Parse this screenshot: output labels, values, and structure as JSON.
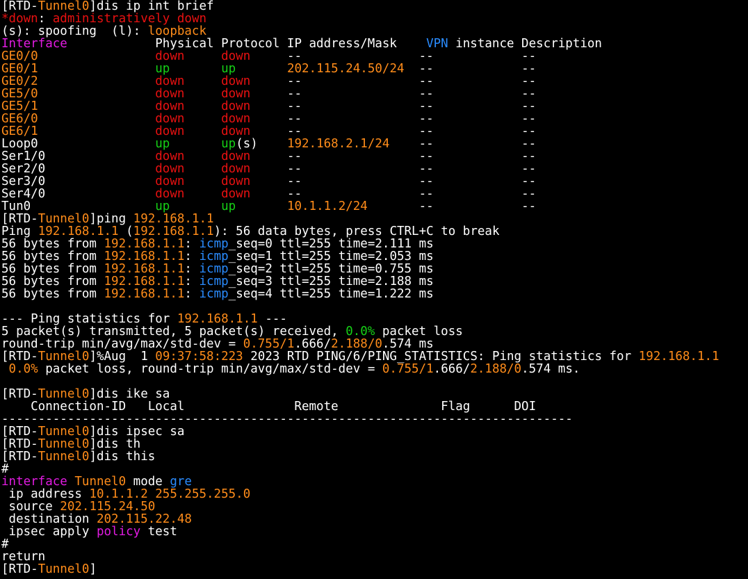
{
  "colors": {
    "background": "#000000",
    "default_text": "#ffffff",
    "orange": "#ff8c1a",
    "red": "#e81111",
    "green": "#16d116",
    "magenta": "#e21be2",
    "blue": "#2a8cff"
  },
  "lines": [
    [
      [
        "w",
        "[RTD-"
      ],
      [
        "o",
        "Tunnel0"
      ],
      [
        "w",
        "]dis ip int brief"
      ]
    ],
    [
      [
        "r",
        "*down"
      ],
      [
        "w",
        ": "
      ],
      [
        "r",
        "administratively down"
      ]
    ],
    [
      [
        "w",
        "(s): spoofing  (l): "
      ],
      [
        "o",
        "loopback"
      ]
    ],
    [
      [
        "m",
        "Interface"
      ],
      [
        "w",
        "            Physical Protocol IP address/Mask    "
      ],
      [
        "b",
        "VPN"
      ],
      [
        "w",
        " instance Description"
      ]
    ],
    [
      [
        "o",
        "GE0/0"
      ],
      [
        "w",
        "                "
      ],
      [
        "r",
        "down"
      ],
      [
        "w",
        "     "
      ],
      [
        "r",
        "down"
      ],
      [
        "w",
        "     --                --            --"
      ]
    ],
    [
      [
        "o",
        "GE0/1"
      ],
      [
        "w",
        "                "
      ],
      [
        "g",
        "up"
      ],
      [
        "w",
        "       "
      ],
      [
        "g",
        "up"
      ],
      [
        "w",
        "       "
      ],
      [
        "o",
        "202.115.24.50/24"
      ],
      [
        "w",
        "  --            --"
      ]
    ],
    [
      [
        "o",
        "GE0/2"
      ],
      [
        "w",
        "                "
      ],
      [
        "r",
        "down"
      ],
      [
        "w",
        "     "
      ],
      [
        "r",
        "down"
      ],
      [
        "w",
        "     --                --            --"
      ]
    ],
    [
      [
        "o",
        "GE5/0"
      ],
      [
        "w",
        "                "
      ],
      [
        "r",
        "down"
      ],
      [
        "w",
        "     "
      ],
      [
        "r",
        "down"
      ],
      [
        "w",
        "     --                --            --"
      ]
    ],
    [
      [
        "o",
        "GE5/1"
      ],
      [
        "w",
        "                "
      ],
      [
        "r",
        "down"
      ],
      [
        "w",
        "     "
      ],
      [
        "r",
        "down"
      ],
      [
        "w",
        "     --                --            --"
      ]
    ],
    [
      [
        "o",
        "GE6/0"
      ],
      [
        "w",
        "                "
      ],
      [
        "r",
        "down"
      ],
      [
        "w",
        "     "
      ],
      [
        "r",
        "down"
      ],
      [
        "w",
        "     --                --            --"
      ]
    ],
    [
      [
        "o",
        "GE6/1"
      ],
      [
        "w",
        "                "
      ],
      [
        "r",
        "down"
      ],
      [
        "w",
        "     "
      ],
      [
        "r",
        "down"
      ],
      [
        "w",
        "     --                --            --"
      ]
    ],
    [
      [
        "w",
        "Loop0                "
      ],
      [
        "g",
        "up"
      ],
      [
        "w",
        "       "
      ],
      [
        "g",
        "up"
      ],
      [
        "w",
        "(s)    "
      ],
      [
        "o",
        "192.168.2.1/24"
      ],
      [
        "w",
        "    --            --"
      ]
    ],
    [
      [
        "w",
        "Ser1/0               "
      ],
      [
        "r",
        "down"
      ],
      [
        "w",
        "     "
      ],
      [
        "r",
        "down"
      ],
      [
        "w",
        "     --                --            --"
      ]
    ],
    [
      [
        "w",
        "Ser2/0               "
      ],
      [
        "r",
        "down"
      ],
      [
        "w",
        "     "
      ],
      [
        "r",
        "down"
      ],
      [
        "w",
        "     --                --            --"
      ]
    ],
    [
      [
        "w",
        "Ser3/0               "
      ],
      [
        "r",
        "down"
      ],
      [
        "w",
        "     "
      ],
      [
        "r",
        "down"
      ],
      [
        "w",
        "     --                --            --"
      ]
    ],
    [
      [
        "w",
        "Ser4/0               "
      ],
      [
        "r",
        "down"
      ],
      [
        "w",
        "     "
      ],
      [
        "r",
        "down"
      ],
      [
        "w",
        "     --                --            --"
      ]
    ],
    [
      [
        "w",
        "Tun0                 "
      ],
      [
        "g",
        "up"
      ],
      [
        "w",
        "       "
      ],
      [
        "g",
        "up"
      ],
      [
        "w",
        "       "
      ],
      [
        "o",
        "10.1.1.2/24"
      ],
      [
        "w",
        "       --            --"
      ]
    ],
    [
      [
        "w",
        "[RTD-"
      ],
      [
        "o",
        "Tunnel0"
      ],
      [
        "w",
        "]ping "
      ],
      [
        "o",
        "192.168.1.1"
      ]
    ],
    [
      [
        "w",
        "Ping "
      ],
      [
        "o",
        "192.168.1.1"
      ],
      [
        "w",
        " ("
      ],
      [
        "o",
        "192.168.1.1"
      ],
      [
        "w",
        "): 56 data bytes, press CTRL+C to break"
      ]
    ],
    [
      [
        "w",
        "56 bytes from "
      ],
      [
        "o",
        "192.168.1.1"
      ],
      [
        "w",
        ": "
      ],
      [
        "b",
        "icmp"
      ],
      [
        "w",
        "_seq=0 ttl=255 time=2.111 ms"
      ]
    ],
    [
      [
        "w",
        "56 bytes from "
      ],
      [
        "o",
        "192.168.1.1"
      ],
      [
        "w",
        ": "
      ],
      [
        "b",
        "icmp"
      ],
      [
        "w",
        "_seq=1 ttl=255 time=2.053 ms"
      ]
    ],
    [
      [
        "w",
        "56 bytes from "
      ],
      [
        "o",
        "192.168.1.1"
      ],
      [
        "w",
        ": "
      ],
      [
        "b",
        "icmp"
      ],
      [
        "w",
        "_seq=2 ttl=255 time=0.755 ms"
      ]
    ],
    [
      [
        "w",
        "56 bytes from "
      ],
      [
        "o",
        "192.168.1.1"
      ],
      [
        "w",
        ": "
      ],
      [
        "b",
        "icmp"
      ],
      [
        "w",
        "_seq=3 ttl=255 time=2.188 ms"
      ]
    ],
    [
      [
        "w",
        "56 bytes from "
      ],
      [
        "o",
        "192.168.1.1"
      ],
      [
        "w",
        ": "
      ],
      [
        "b",
        "icmp"
      ],
      [
        "w",
        "_seq=4 ttl=255 time=1.222 ms"
      ]
    ],
    [
      [
        "w",
        ""
      ]
    ],
    [
      [
        "w",
        "--- Ping statistics for "
      ],
      [
        "o",
        "192.168.1.1"
      ],
      [
        "w",
        " ---"
      ]
    ],
    [
      [
        "w",
        "5 packet(s) transmitted, 5 packet(s) received, "
      ],
      [
        "g",
        "0.0%"
      ],
      [
        "w",
        " packet loss"
      ]
    ],
    [
      [
        "w",
        "round-trip min/avg/max/std-dev = "
      ],
      [
        "o",
        "0.755/1"
      ],
      [
        "w",
        ".666/"
      ],
      [
        "o",
        "2.188/0"
      ],
      [
        "w",
        ".574 ms"
      ]
    ],
    [
      [
        "w",
        "[RTD-"
      ],
      [
        "o",
        "Tunnel0"
      ],
      [
        "w",
        "]%Aug  1 "
      ],
      [
        "o",
        "09:37:58:223"
      ],
      [
        "w",
        " 2023 RTD PING/6/PING_STATISTICS: Ping statistics for "
      ],
      [
        "o",
        "192.168.1.1"
      ]
    ],
    [
      [
        "w",
        " "
      ],
      [
        "o",
        "0.0%"
      ],
      [
        "w",
        " packet loss, round-trip min/avg/max/std-dev = "
      ],
      [
        "o",
        "0.755/1"
      ],
      [
        "w",
        ".666/"
      ],
      [
        "o",
        "2.188/0"
      ],
      [
        "w",
        ".574 ms."
      ]
    ],
    [
      [
        "w",
        ""
      ]
    ],
    [
      [
        "w",
        "[RTD-"
      ],
      [
        "o",
        "Tunnel0"
      ],
      [
        "w",
        "]dis ike sa"
      ]
    ],
    [
      [
        "w",
        "    Connection-ID   Local               Remote              Flag      DOI"
      ]
    ],
    [
      [
        "w",
        "------------------------------------------------------------------------------"
      ]
    ],
    [
      [
        "w",
        "[RTD-"
      ],
      [
        "o",
        "Tunnel0"
      ],
      [
        "w",
        "]dis ipsec sa"
      ]
    ],
    [
      [
        "w",
        "[RTD-"
      ],
      [
        "o",
        "Tunnel0"
      ],
      [
        "w",
        "]dis th"
      ]
    ],
    [
      [
        "w",
        "[RTD-"
      ],
      [
        "o",
        "Tunnel0"
      ],
      [
        "w",
        "]dis this"
      ]
    ],
    [
      [
        "w",
        "#"
      ]
    ],
    [
      [
        "m",
        "interface"
      ],
      [
        "w",
        " "
      ],
      [
        "o",
        "Tunnel0"
      ],
      [
        "w",
        " mode "
      ],
      [
        "b",
        "gre"
      ]
    ],
    [
      [
        "w",
        " ip address "
      ],
      [
        "o",
        "10.1.1.2 255.255.255.0"
      ]
    ],
    [
      [
        "w",
        " source "
      ],
      [
        "o",
        "202.115.24.50"
      ]
    ],
    [
      [
        "w",
        " destination "
      ],
      [
        "o",
        "202.115.22.48"
      ]
    ],
    [
      [
        "w",
        " ipsec apply "
      ],
      [
        "m",
        "policy"
      ],
      [
        "w",
        " test"
      ]
    ],
    [
      [
        "w",
        "#"
      ]
    ],
    [
      [
        "w",
        "return"
      ]
    ],
    [
      [
        "w",
        "[RTD-"
      ],
      [
        "o",
        "Tunnel0"
      ],
      [
        "w",
        "]"
      ]
    ]
  ]
}
